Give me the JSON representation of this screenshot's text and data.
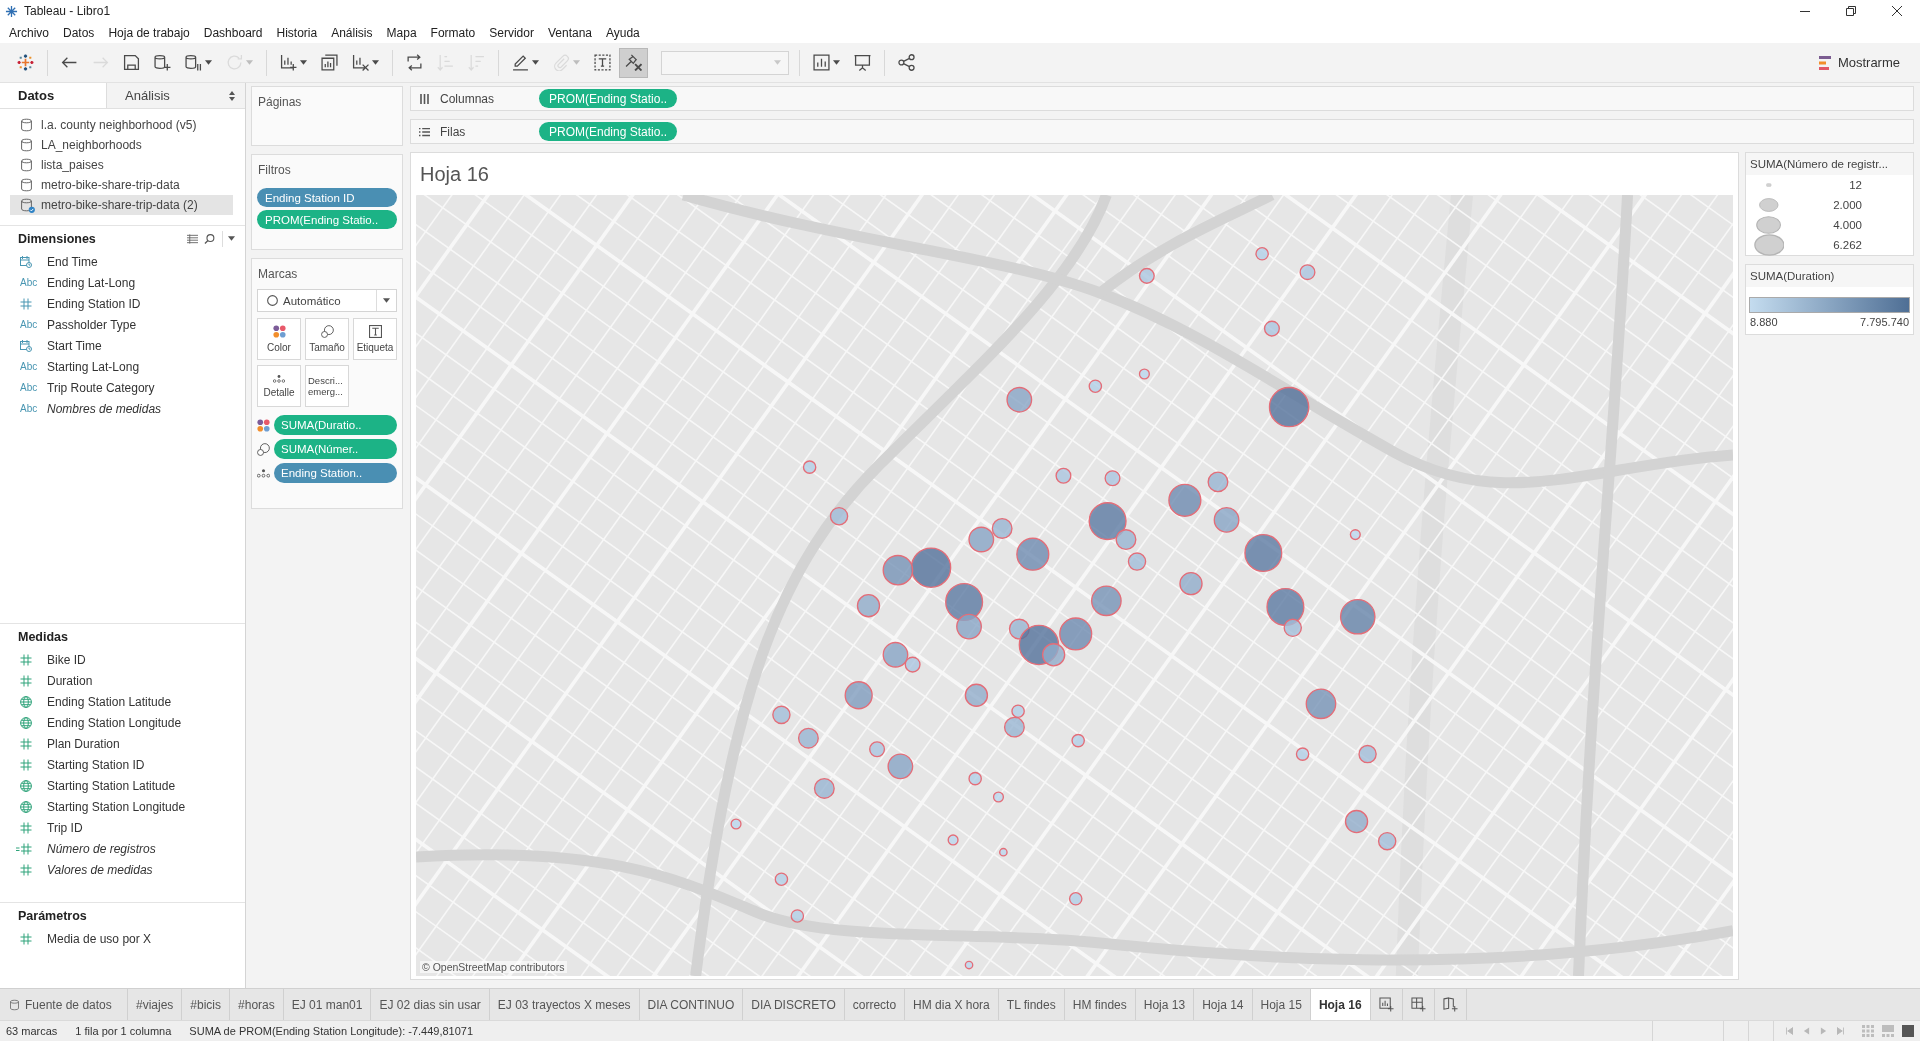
{
  "window": {
    "title": "Tableau - Libro1"
  },
  "menu": [
    "Archivo",
    "Datos",
    "Hoja de trabajo",
    "Dashboard",
    "Historia",
    "Análisis",
    "Mapa",
    "Formato",
    "Servidor",
    "Ventana",
    "Ayuda"
  ],
  "toolbar": {
    "groups": [
      [
        {
          "kind": "logo",
          "disabled": false,
          "pressed": false,
          "menu": false
        }
      ],
      [
        {
          "kind": "back",
          "disabled": false,
          "pressed": false,
          "menu": false
        },
        {
          "kind": "forward",
          "disabled": true,
          "pressed": false,
          "menu": false
        },
        {
          "kind": "save",
          "disabled": false,
          "pressed": false,
          "menu": false
        },
        {
          "kind": "new-source",
          "disabled": false,
          "pressed": false,
          "menu": false
        },
        {
          "kind": "pause",
          "disabled": false,
          "pressed": false,
          "menu": true
        },
        {
          "kind": "refresh",
          "disabled": true,
          "pressed": false,
          "menu": true
        }
      ],
      [
        {
          "kind": "new-sheet",
          "disabled": false,
          "pressed": false,
          "menu": true
        },
        {
          "kind": "duplicate",
          "disabled": false,
          "pressed": false,
          "menu": false
        },
        {
          "kind": "clear",
          "disabled": false,
          "pressed": false,
          "menu": true
        }
      ],
      [
        {
          "kind": "swap",
          "disabled": false,
          "pressed": false,
          "menu": false
        },
        {
          "kind": "sort-asc",
          "disabled": true,
          "pressed": false,
          "menu": false
        },
        {
          "kind": "sort-desc",
          "disabled": true,
          "pressed": false,
          "menu": false
        }
      ],
      [
        {
          "kind": "highlight",
          "disabled": false,
          "pressed": false,
          "menu": true
        },
        {
          "kind": "group",
          "disabled": true,
          "pressed": false,
          "menu": true
        },
        {
          "kind": "labels",
          "disabled": false,
          "pressed": false,
          "menu": false
        },
        {
          "kind": "fix-axes",
          "disabled": false,
          "pressed": true,
          "menu": false
        },
        {
          "kind": "combo",
          "disabled": true,
          "pressed": false,
          "menu": true
        }
      ],
      [
        {
          "kind": "fit",
          "disabled": false,
          "pressed": false,
          "menu": true
        },
        {
          "kind": "present",
          "disabled": false,
          "pressed": false,
          "menu": false
        }
      ],
      [
        {
          "kind": "share",
          "disabled": false,
          "pressed": false,
          "menu": false
        }
      ]
    ],
    "show_me": "Mostrarme"
  },
  "data_pane": {
    "tabs": [
      {
        "label": "Datos",
        "selected": true,
        "menu": false
      },
      {
        "label": "Análisis",
        "selected": false,
        "menu": true
      }
    ],
    "sources": [
      {
        "name": "l.a. county neighborhood (v5)",
        "selected": false,
        "in_use": false
      },
      {
        "name": "LA_neighborhoods",
        "selected": false,
        "in_use": false
      },
      {
        "name": "lista_paises",
        "selected": false,
        "in_use": false
      },
      {
        "name": "metro-bike-share-trip-data",
        "selected": false,
        "in_use": false
      },
      {
        "name": "metro-bike-share-trip-data (2)",
        "selected": true,
        "in_use": true
      }
    ],
    "sections": [
      {
        "kind": "dimensions",
        "title": "Dimensiones",
        "fields": [
          {
            "name": "End Time",
            "kind": "date",
            "italic": false
          },
          {
            "name": "Ending Lat-Long",
            "kind": "string",
            "icon": "Abc",
            "italic": false
          },
          {
            "name": "Ending Station ID",
            "kind": "number",
            "italic": false
          },
          {
            "name": "Passholder Type",
            "kind": "string",
            "icon": "Abc",
            "italic": false
          },
          {
            "name": "Start Time",
            "kind": "date",
            "italic": false
          },
          {
            "name": "Starting Lat-Long",
            "kind": "string",
            "icon": "Abc",
            "italic": false
          },
          {
            "name": "Trip Route Category",
            "kind": "string",
            "icon": "Abc",
            "italic": false
          },
          {
            "name": "Nombres de medidas",
            "kind": "string",
            "icon": "Abc",
            "italic": true
          }
        ]
      },
      {
        "kind": "measures",
        "title": "Medidas",
        "fields": [
          {
            "name": "Bike ID",
            "kind": "number",
            "italic": false
          },
          {
            "name": "Duration",
            "kind": "number",
            "italic": false
          },
          {
            "name": "Ending Station Latitude",
            "kind": "geo",
            "italic": false
          },
          {
            "name": "Ending Station Longitude",
            "kind": "geo",
            "italic": false
          },
          {
            "name": "Plan Duration",
            "kind": "number",
            "italic": false
          },
          {
            "name": "Starting Station ID",
            "kind": "number",
            "italic": false
          },
          {
            "name": "Starting Station Latitude",
            "kind": "geo",
            "italic": false
          },
          {
            "name": "Starting Station Longitude",
            "kind": "geo",
            "italic": false
          },
          {
            "name": "Trip ID",
            "kind": "number",
            "italic": false
          },
          {
            "name": "Número de registros",
            "kind": "calc",
            "italic": true
          },
          {
            "name": "Valores de medidas",
            "kind": "number",
            "italic": true
          }
        ]
      },
      {
        "kind": "parameters",
        "title": "Parámetros",
        "fields": [
          {
            "name": "Media de uso por X",
            "kind": "number",
            "italic": false
          }
        ]
      }
    ]
  },
  "cards": {
    "pages": {
      "title": "Páginas"
    },
    "filters": {
      "title": "Filtros",
      "pills": [
        {
          "label": "Ending Station ID",
          "discrete": true
        },
        {
          "label": "PROM(Ending Statio..",
          "discrete": false
        }
      ]
    },
    "marks": {
      "title": "Marcas",
      "mark_type": "Automático",
      "properties": [
        {
          "kind": "color",
          "label": "Color"
        },
        {
          "kind": "size",
          "label": "Tamaño"
        },
        {
          "kind": "label",
          "label": "Etiqueta"
        },
        {
          "kind": "detail",
          "label": "Detalle"
        },
        {
          "kind": "tooltip",
          "label": "Descri... emerg..."
        }
      ],
      "pills": [
        {
          "kind": "color",
          "label": "SUMA(Duratio..",
          "discrete": false
        },
        {
          "kind": "size",
          "label": "SUMA(Númer..",
          "discrete": false
        },
        {
          "kind": "detail",
          "label": "Ending Station..",
          "discrete": true
        }
      ]
    }
  },
  "shelves": [
    {
      "kind": "columns",
      "label": "Columnas",
      "pills": [
        {
          "label": "PROM(Ending Statio..",
          "discrete": false
        }
      ]
    },
    {
      "kind": "rows",
      "label": "Filas",
      "pills": [
        {
          "label": "PROM(Ending Statio..",
          "discrete": false
        }
      ]
    }
  ],
  "sheet": {
    "title": "Hoja 16",
    "attribution": "© OpenStreetMap contributors"
  },
  "legends": [
    {
      "kind": "size",
      "title": "SUMA(Número de registr...",
      "entries": [
        "12",
        "2.000",
        "4.000",
        "6.262"
      ]
    },
    {
      "kind": "color",
      "title": "SUMA(Duration)",
      "min": "8.880",
      "max": "7.795.740"
    }
  ],
  "sheet_tabs": [
    {
      "label": "Fuente de datos",
      "kind": "datasource",
      "selected": false
    },
    {
      "label": "#viajes",
      "kind": "sheet",
      "selected": false
    },
    {
      "label": "#bicis",
      "kind": "sheet",
      "selected": false
    },
    {
      "label": "#horas",
      "kind": "sheet",
      "selected": false
    },
    {
      "label": "EJ 01 man01",
      "kind": "sheet",
      "selected": false
    },
    {
      "label": "EJ 02 dias sin usar",
      "kind": "sheet",
      "selected": false
    },
    {
      "label": "EJ 03 trayectos X meses",
      "kind": "sheet",
      "selected": false
    },
    {
      "label": "DIA CONTINUO",
      "kind": "sheet",
      "selected": false
    },
    {
      "label": "DIA DISCRETO",
      "kind": "sheet",
      "selected": false
    },
    {
      "label": "correcto",
      "kind": "sheet",
      "selected": false
    },
    {
      "label": "HM dia X hora",
      "kind": "sheet",
      "selected": false
    },
    {
      "label": "TL findes",
      "kind": "sheet",
      "selected": false
    },
    {
      "label": "HM findes",
      "kind": "sheet",
      "selected": false
    },
    {
      "label": "Hoja 13",
      "kind": "sheet",
      "selected": false
    },
    {
      "label": "Hoja 14",
      "kind": "sheet",
      "selected": false
    },
    {
      "label": "Hoja 15",
      "kind": "sheet",
      "selected": false
    },
    {
      "label": "Hoja 16",
      "kind": "sheet",
      "selected": true
    }
  ],
  "status_bar": {
    "items": [
      "63 marcas",
      "1 fila por 1 columna",
      "SUMA de PROM(Ending Station Longitude): -7.449,81071"
    ],
    "nav": [
      {
        "kind": "first",
        "disabled": true
      },
      {
        "kind": "prev",
        "disabled": true
      },
      {
        "kind": "next",
        "disabled": true
      },
      {
        "kind": "last",
        "disabled": true
      }
    ],
    "views": [
      {
        "kind": "grid",
        "selected": false
      },
      {
        "kind": "filmstrip",
        "selected": false
      },
      {
        "kind": "single",
        "selected": true
      }
    ]
  }
}
